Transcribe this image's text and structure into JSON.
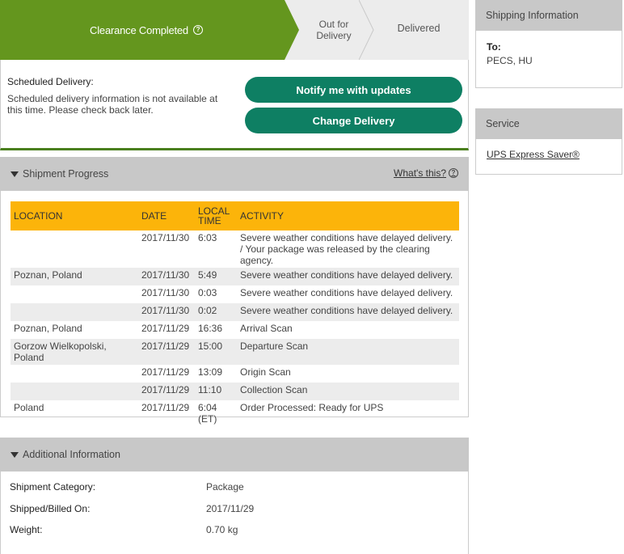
{
  "progress_steps": {
    "active": "Clearance Completed",
    "out_for_delivery": [
      "Out for",
      "Delivery"
    ],
    "delivered": "Delivered"
  },
  "scheduled": {
    "title": "Scheduled Delivery:",
    "text": "Scheduled delivery information is not available at this time. Please check back later.",
    "notify_button": "Notify me with updates",
    "change_button": "Change Delivery"
  },
  "shipment_progress": {
    "header": "Shipment Progress",
    "whats_this": "What's this?",
    "columns": [
      "LOCATION",
      "DATE",
      "LOCAL TIME",
      "ACTIVITY"
    ],
    "rows": [
      {
        "location": "",
        "date": "2017/11/30",
        "time": "6:03",
        "activity": "Severe weather conditions have delayed delivery. / Your package was released by the clearing agency."
      },
      {
        "location": "Poznan,  Poland",
        "date": "2017/11/30",
        "time": "5:49",
        "activity": "Severe weather conditions have delayed delivery."
      },
      {
        "location": "",
        "date": "2017/11/30",
        "time": "0:03",
        "activity": "Severe weather conditions have delayed delivery."
      },
      {
        "location": "",
        "date": "2017/11/30",
        "time": "0:02",
        "activity": "Severe weather conditions have delayed delivery."
      },
      {
        "location": "Poznan,  Poland",
        "date": "2017/11/29",
        "time": "16:36",
        "activity": "Arrival Scan"
      },
      {
        "location": "Gorzow Wielkopolski,  Poland",
        "date": "2017/11/29",
        "time": "15:00",
        "activity": "Departure Scan"
      },
      {
        "location": "",
        "date": "2017/11/29",
        "time": "13:09",
        "activity": "Origin Scan"
      },
      {
        "location": "",
        "date": "2017/11/29",
        "time": "11:10",
        "activity": "Collection Scan"
      },
      {
        "location": "Poland",
        "date": "2017/11/29",
        "time": "6:04 (ET)",
        "activity": "Order Processed: Ready for UPS"
      }
    ]
  },
  "additional_info": {
    "header": "Additional Information",
    "shipment_category_label": "Shipment Category:",
    "shipment_category": "Package",
    "shipped_label": "Shipped/Billed On:",
    "shipped": "2017/11/29",
    "weight_label": "Weight:",
    "weight": "0.70 kg"
  },
  "shipping_information": {
    "header": "Shipping Information",
    "to_label": "To:",
    "to_value": "PECS,  HU"
  },
  "service": {
    "header": "Service",
    "link": "UPS Express Saver®"
  },
  "colors": {
    "active_step": "#64961e",
    "button": "#0e7f63",
    "table_header": "#fcb40a",
    "section_header": "#c8c8c8"
  }
}
